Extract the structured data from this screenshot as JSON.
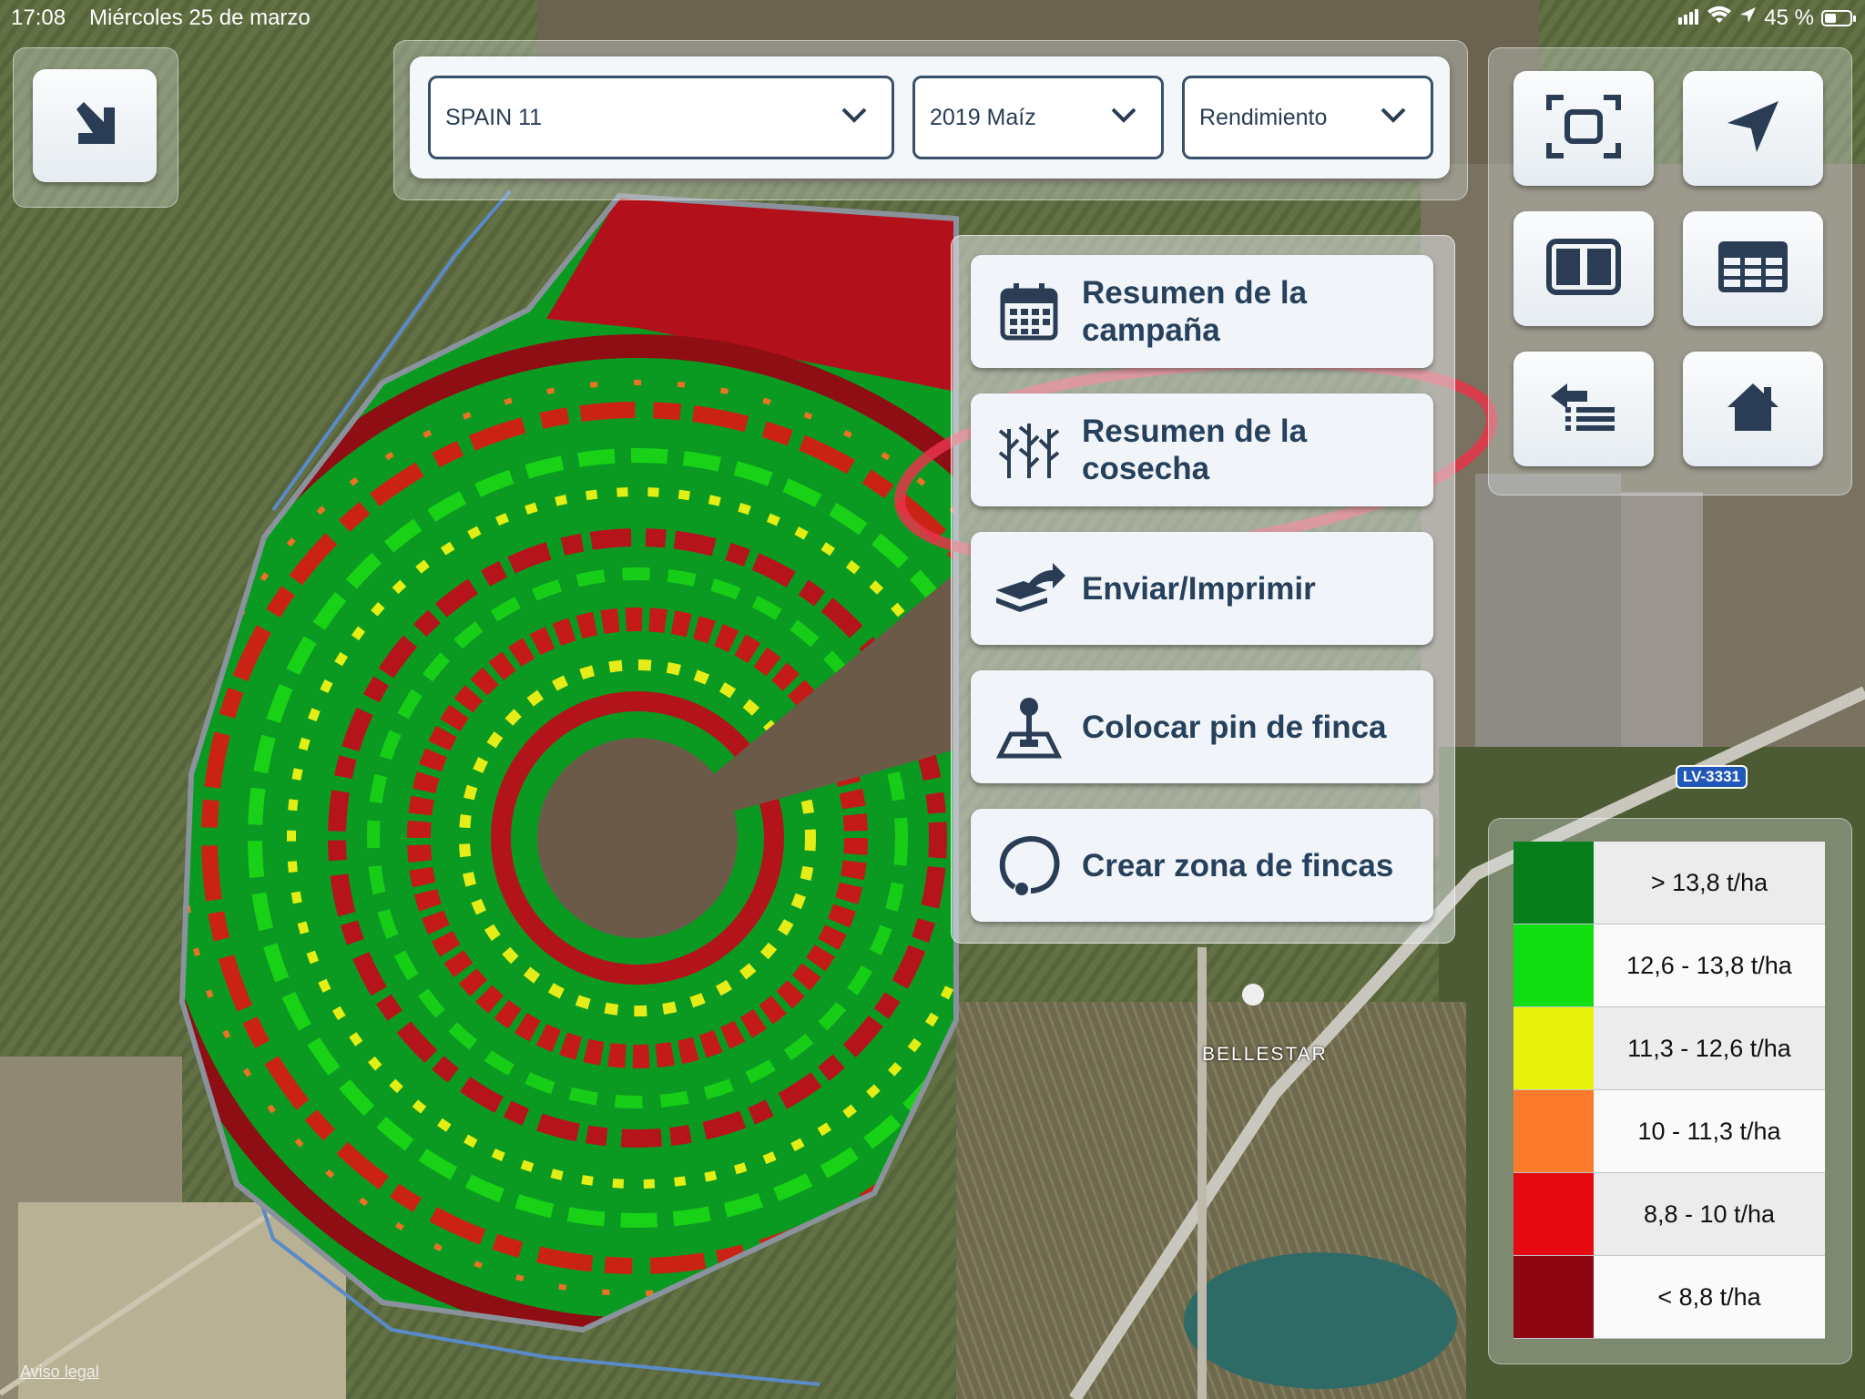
{
  "status_bar": {
    "time": "17:08",
    "date": "Miércoles 25 de marzo",
    "battery": "45 %"
  },
  "selectors": {
    "farm": "SPAIN 11",
    "season": "2019 Maíz",
    "layer": "Rendimiento"
  },
  "menu": {
    "items": [
      {
        "label": "Resumen de la\ncampaña",
        "icon": "calendar-icon"
      },
      {
        "label": "Resumen de la\ncosecha",
        "icon": "crop-icon"
      },
      {
        "label": "Enviar/Imprimir",
        "icon": "send-icon"
      },
      {
        "label": "Colocar pin de finca",
        "icon": "pin-icon"
      },
      {
        "label": "Crear zona de fincas",
        "icon": "zone-icon"
      }
    ]
  },
  "toolbar": {
    "buttons": [
      "fit-extent-icon",
      "locate-arrow-icon",
      "split-view-icon",
      "table-view-icon",
      "back-list-icon",
      "home-icon"
    ]
  },
  "legend": {
    "items": [
      {
        "label": "> 13,8 t/ha",
        "color": "#067e1c"
      },
      {
        "label": "12,6 - 13,8 t/ha",
        "color": "#10de10"
      },
      {
        "label": "11,3 - 12,6 t/ha",
        "color": "#e8f20a"
      },
      {
        "label": "10 - 11,3 t/ha",
        "color": "#fb7a2c"
      },
      {
        "label": "8,8 - 10 t/ha",
        "color": "#e50912"
      },
      {
        "label": "< 8,8 t/ha",
        "color": "#8d0612"
      }
    ]
  },
  "map": {
    "place_label": "BELLESTAR",
    "road_label": "LV-3331",
    "legal_link": "Aviso legal"
  },
  "colors": {
    "accent": "#2a3d55",
    "highlight": "#e8344a"
  }
}
